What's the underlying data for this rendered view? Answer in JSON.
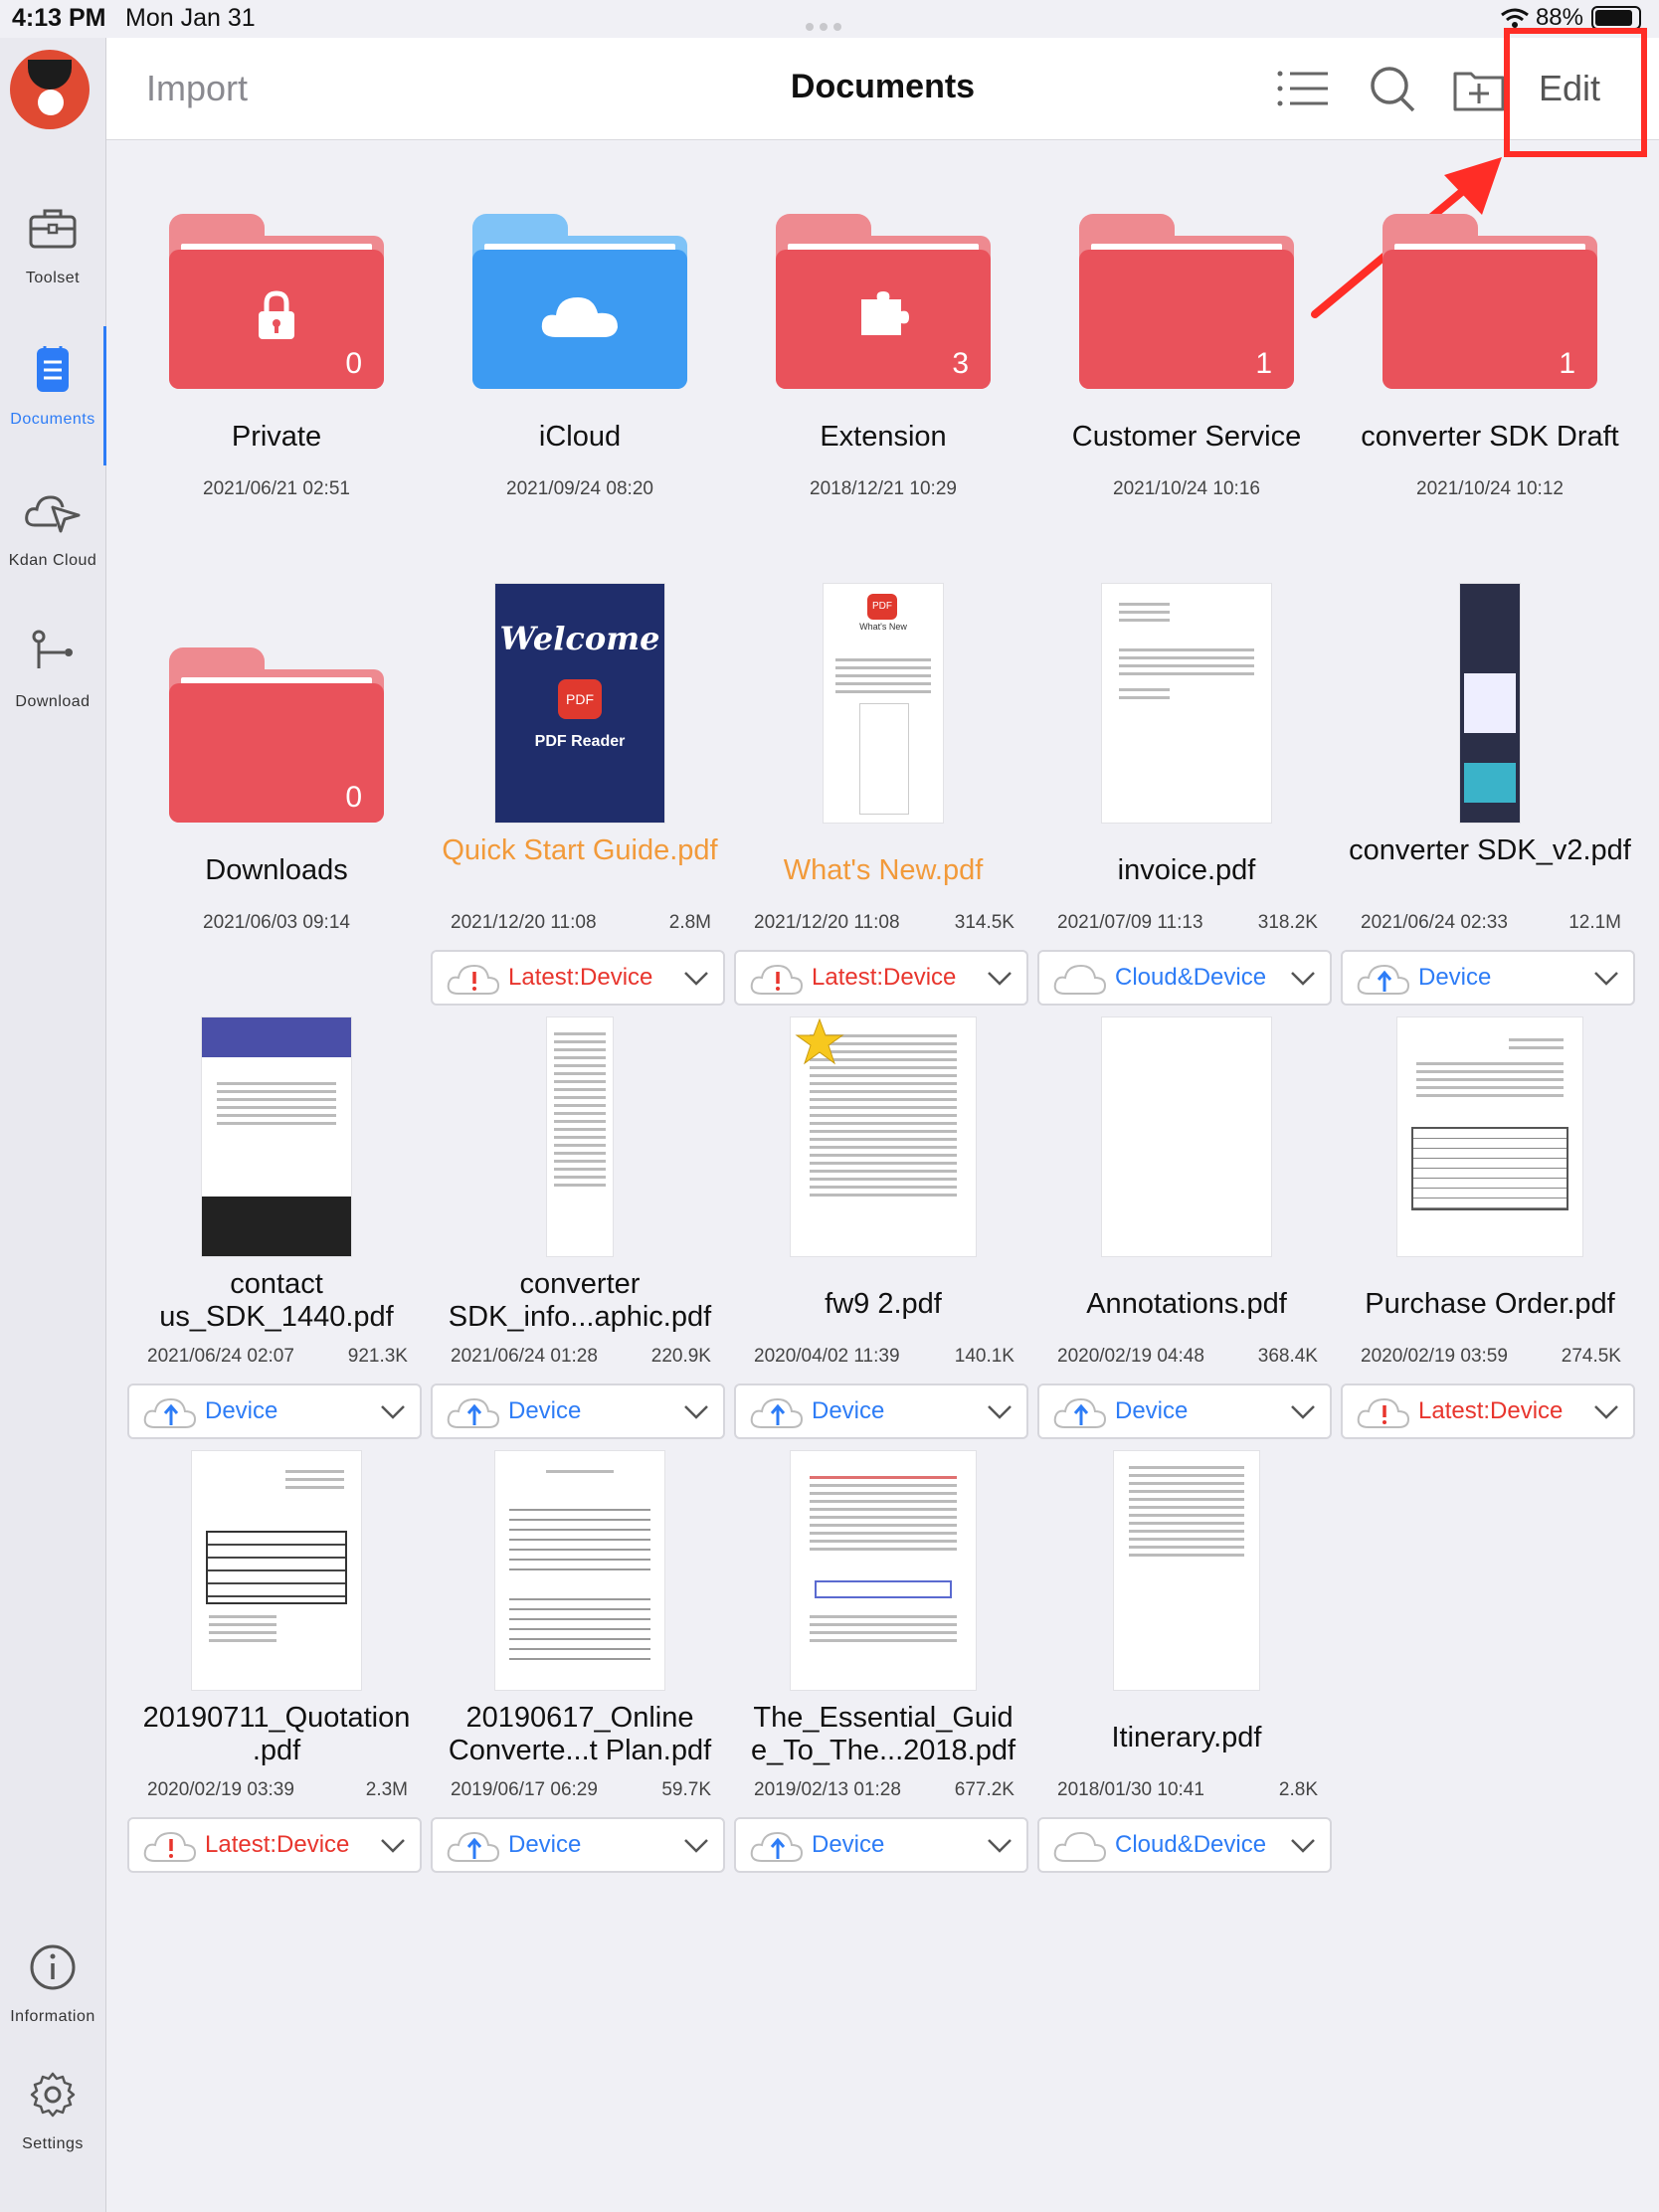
{
  "status": {
    "time": "4:13 PM",
    "date": "Mon Jan 31",
    "battery": "88%"
  },
  "sidebar": {
    "items": [
      {
        "label": "Toolset"
      },
      {
        "label": "Documents"
      },
      {
        "label": "Kdan Cloud"
      },
      {
        "label": "Download"
      },
      {
        "label": "Information"
      },
      {
        "label": "Settings"
      }
    ]
  },
  "header": {
    "import_label": "Import",
    "title": "Documents",
    "edit_label": "Edit"
  },
  "colors": {
    "folder_red": "#e9525b",
    "folder_blue": "#3d9bf2",
    "accent": "#2d7cf6",
    "warning": "#e8352d",
    "highlight": "#ff2d26"
  },
  "folders": [
    {
      "name": "Private",
      "date": "2021/06/21 02:51",
      "count": "0",
      "icon": "lock-icon",
      "color": "red"
    },
    {
      "name": "iCloud",
      "date": "2021/09/24 08:20",
      "count": "",
      "icon": "cloud-icon",
      "color": "blue"
    },
    {
      "name": "Extension",
      "date": "2018/12/21 10:29",
      "count": "3",
      "icon": "puzzle-icon",
      "color": "red"
    },
    {
      "name": "Customer Service",
      "date": "2021/10/24 10:16",
      "count": "1",
      "icon": "",
      "color": "red"
    },
    {
      "name": "converter SDK Draft",
      "date": "2021/10/24 10:12",
      "count": "1",
      "icon": "",
      "color": "red"
    },
    {
      "name": "Downloads",
      "date": "2021/06/03 09:14",
      "count": "0",
      "icon": "",
      "color": "red"
    }
  ],
  "files": [
    {
      "name": "Quick Start Guide.pdf",
      "date": "2021/12/20 11:08",
      "size": "2.8M",
      "status": "Latest:Device",
      "status_type": "warning",
      "highlight": true,
      "thumb_text": [
        "Welcome",
        "PDF",
        "PDF Reader"
      ]
    },
    {
      "name": "What's New.pdf",
      "date": "2021/12/20 11:08",
      "size": "314.5K",
      "status": "Latest:Device",
      "status_type": "warning",
      "highlight": true,
      "thumb_text": [
        "PDF",
        "What's New"
      ]
    },
    {
      "name": "invoice.pdf",
      "date": "2021/07/09 11:13",
      "size": "318.2K",
      "status": "Cloud&Device",
      "status_type": "cloud",
      "highlight": false
    },
    {
      "name": "converter SDK_v2.pdf",
      "date": "2021/06/24 02:33",
      "size": "12.1M",
      "status": "Device",
      "status_type": "upload",
      "highlight": false
    },
    {
      "name": "contact us_SDK_1440.pdf",
      "date": "2021/06/24 02:07",
      "size": "921.3K",
      "status": "Device",
      "status_type": "upload",
      "highlight": false
    },
    {
      "name": "converter SDK_info...aphic.pdf",
      "date": "2021/06/24 01:28",
      "size": "220.9K",
      "status": "Device",
      "status_type": "upload",
      "highlight": false
    },
    {
      "name": "fw9 2.pdf",
      "date": "2020/04/02 11:39",
      "size": "140.1K",
      "status": "Device",
      "status_type": "upload",
      "highlight": false
    },
    {
      "name": "Annotations.pdf",
      "date": "2020/02/19 04:48",
      "size": "368.4K",
      "status": "Device",
      "status_type": "upload",
      "highlight": false
    },
    {
      "name": "Purchase Order.pdf",
      "date": "2020/02/19 03:59",
      "size": "274.5K",
      "status": "Latest:Device",
      "status_type": "warning",
      "highlight": false
    },
    {
      "name": "20190711_Quotation .pdf",
      "date": "2020/02/19 03:39",
      "size": "2.3M",
      "status": "Latest:Device",
      "status_type": "warning",
      "highlight": false
    },
    {
      "name": "20190617_Online Converte...t Plan.pdf",
      "date": "2019/06/17 06:29",
      "size": "59.7K",
      "status": "Device",
      "status_type": "upload",
      "highlight": false
    },
    {
      "name": "The_Essential_Guid e_To_The...2018.pdf",
      "date": "2019/02/13 01:28",
      "size": "677.2K",
      "status": "Device",
      "status_type": "upload",
      "highlight": false
    },
    {
      "name": "Itinerary.pdf",
      "date": "2018/01/30 10:41",
      "size": "2.8K",
      "status": "Cloud&Device",
      "status_type": "cloud",
      "highlight": false
    }
  ]
}
